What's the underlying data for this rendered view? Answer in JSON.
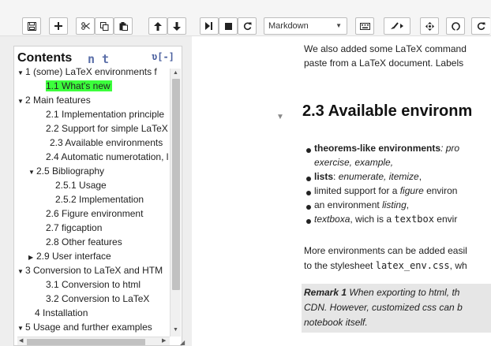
{
  "toolbar": {
    "cell_type": "Markdown",
    "buttons": [
      "save-icon",
      "plus-icon",
      "scissors-icon",
      "copy-icon",
      "paste-icon",
      "arrow-up-icon",
      "arrow-down-icon",
      "step-run-icon",
      "stop-icon",
      "restart-icon",
      "keyboard-icon",
      "format-brush-icon",
      "move-icon",
      "github-icon",
      "refresh-icon"
    ]
  },
  "toc": {
    "title": "Contents",
    "n_button": "n",
    "t_button": "t",
    "reload_button": "ʋ[-]",
    "items": [
      {
        "toggle": "▼",
        "text": "1 (some) LaTeX environments f"
      },
      {
        "toggle": "",
        "text": "1.1 What's new"
      },
      {
        "toggle": "▼",
        "text": "2 Main features"
      },
      {
        "toggle": "",
        "text": "2.1 Implementation principle"
      },
      {
        "toggle": "",
        "text": "2.2 Support for simple LaTeX"
      },
      {
        "toggle": "",
        "text": "2.3 Available environments"
      },
      {
        "toggle": "",
        "text": "2.4 Automatic numerotation, l"
      },
      {
        "toggle": "▼",
        "text": "2.5 Bibliography"
      },
      {
        "toggle": "",
        "text": "2.5.1 Usage"
      },
      {
        "toggle": "",
        "text": "2.5.2 Implementation"
      },
      {
        "toggle": "",
        "text": "2.6 Figure environment"
      },
      {
        "toggle": "",
        "text": "2.7 figcaption"
      },
      {
        "toggle": "",
        "text": "2.8 Other features"
      },
      {
        "toggle": "▶",
        "text": "2.9 User interface"
      },
      {
        "toggle": "▼",
        "text": "3 Conversion to LaTeX and HTM"
      },
      {
        "toggle": "",
        "text": "3.1 Conversion to html"
      },
      {
        "toggle": "",
        "text": "3.2 Conversion to LaTeX"
      },
      {
        "toggle": "",
        "text": "4 Installation"
      },
      {
        "toggle": "▼",
        "text": "5 Usage and further examples"
      }
    ]
  },
  "notebook": {
    "intro_line1": "We also added some LaTeX command",
    "intro_line2": "paste from a LaTeX document. Labels",
    "heading": "2.3  Available environm",
    "b1_bold": "theorems-like environments",
    "b1_rest": ": pro",
    "b1_line2": "exercise, example,",
    "b2_bold": "lists",
    "b2_rest_italic": "enumerate, itemize",
    "b2_sep": ": ",
    "b2_end": ",",
    "b3_pre": "limited support for a ",
    "b3_italic": "figure",
    "b3_post": " environ",
    "b4_pre": "an environment ",
    "b4_italic": "listing",
    "b4_post": ",",
    "b5_italic": "textboxa",
    "b5_mid": ", wich is a ",
    "b5_mono": "textbox",
    "b5_post": " envir",
    "more_line1": "More environments can be added easil",
    "more_line2_pre": "to the stylesheet ",
    "more_line2_mono": "latex_env.css",
    "more_line2_post": ", wh",
    "remark_label": "Remark 1",
    "remark_line1": "  When exporting to html, th",
    "remark_line2": "CDN. However, customized css can b",
    "remark_line3": "notebook itself."
  }
}
